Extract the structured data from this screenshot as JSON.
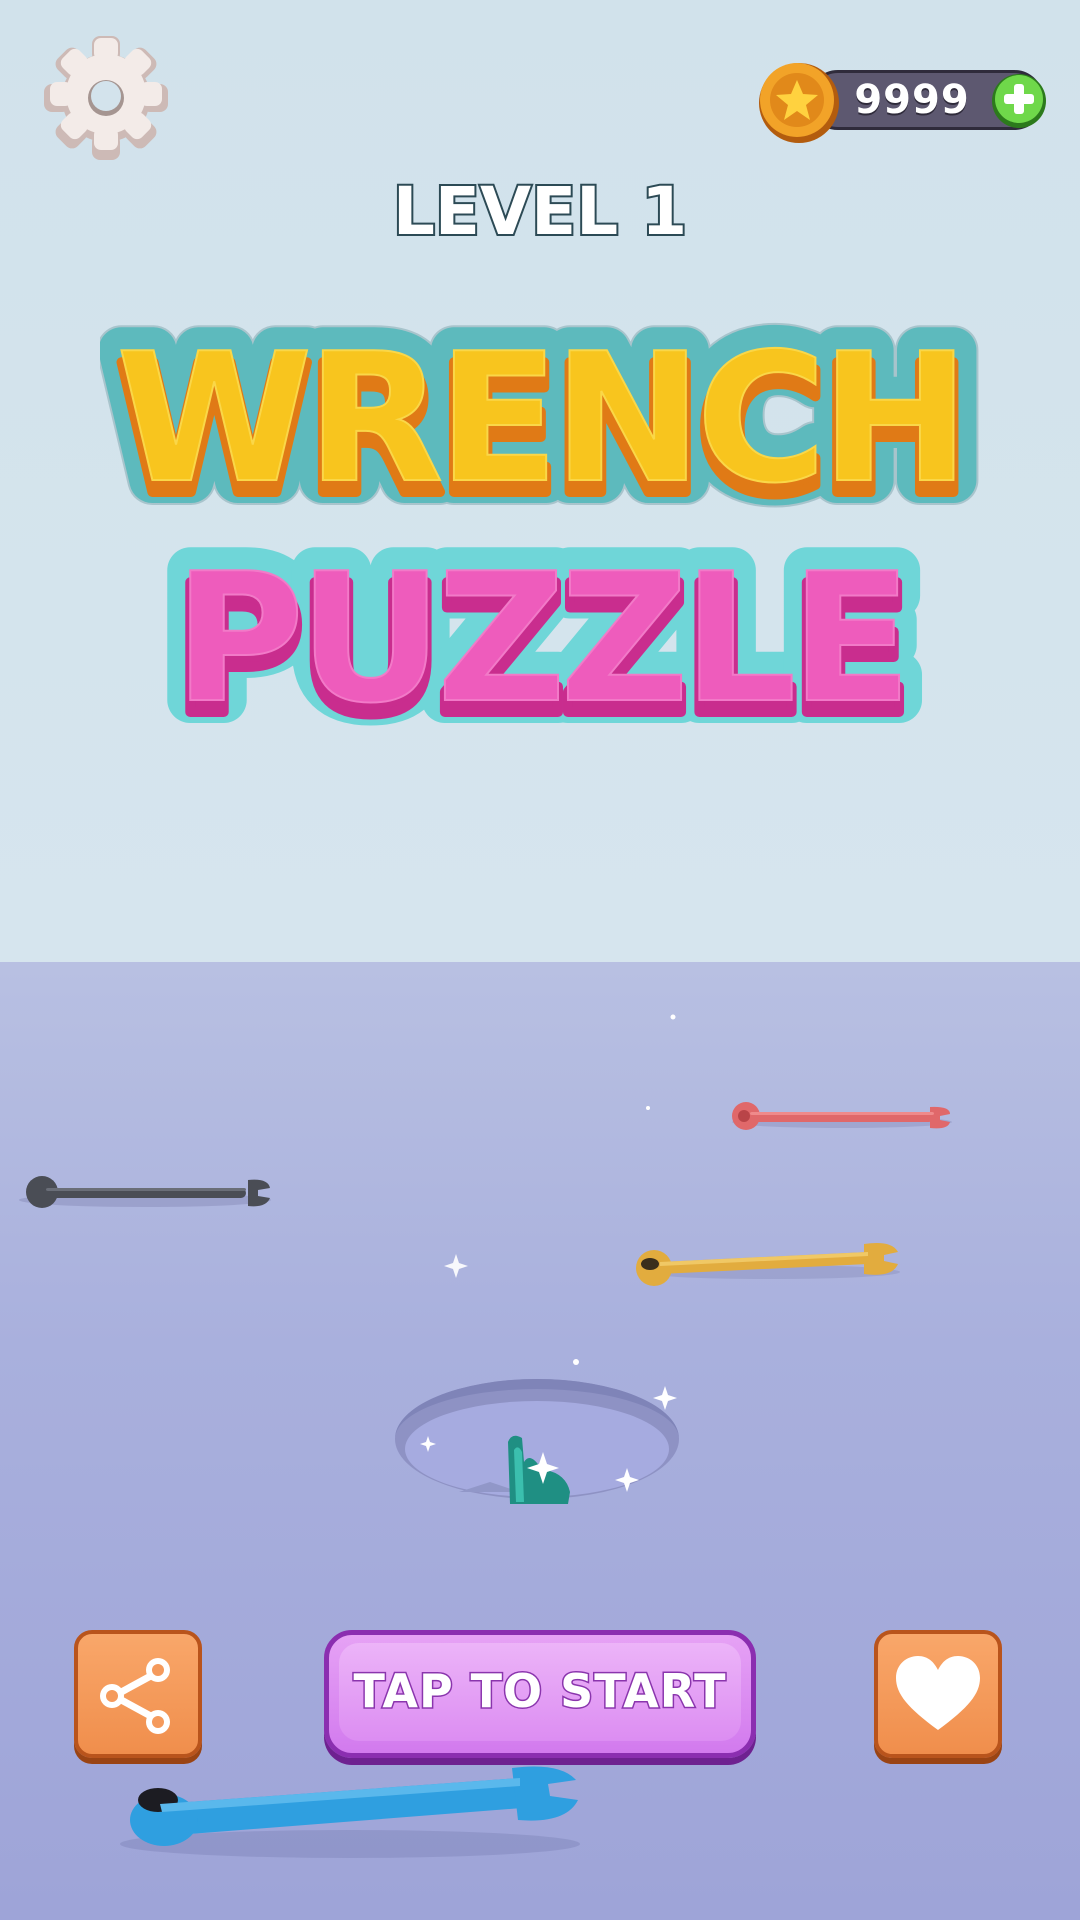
{
  "hud": {
    "settings_icon": "gear-icon",
    "coins": "9999",
    "coin_icon": "star-coin-icon",
    "add_coins_icon": "plus-icon"
  },
  "level": {
    "label": "LEVEL 1"
  },
  "logo": {
    "line1": "WRENCH",
    "line2": "PUZZLE",
    "colors": {
      "line1_fill": "#f8c51e",
      "line1_shadow": "#e07a16",
      "line2_fill": "#ee5cbc",
      "line2_shadow": "#c92d8e",
      "outline": "#6fd6d8"
    }
  },
  "scene": {
    "wrenches": [
      {
        "name": "wrench-dark-gray",
        "color": "#4a4d55"
      },
      {
        "name": "wrench-red",
        "color": "#e0686a"
      },
      {
        "name": "wrench-yellow",
        "color": "#e2ac3e"
      },
      {
        "name": "wrench-teal-in-hole",
        "color": "#2a9d8f"
      },
      {
        "name": "wrench-blue",
        "color": "#2f9fe0"
      }
    ],
    "hole": "target-hole"
  },
  "buttons": {
    "share_icon": "share-icon",
    "start_label": "TAP TO START",
    "favorite_icon": "heart-icon"
  }
}
